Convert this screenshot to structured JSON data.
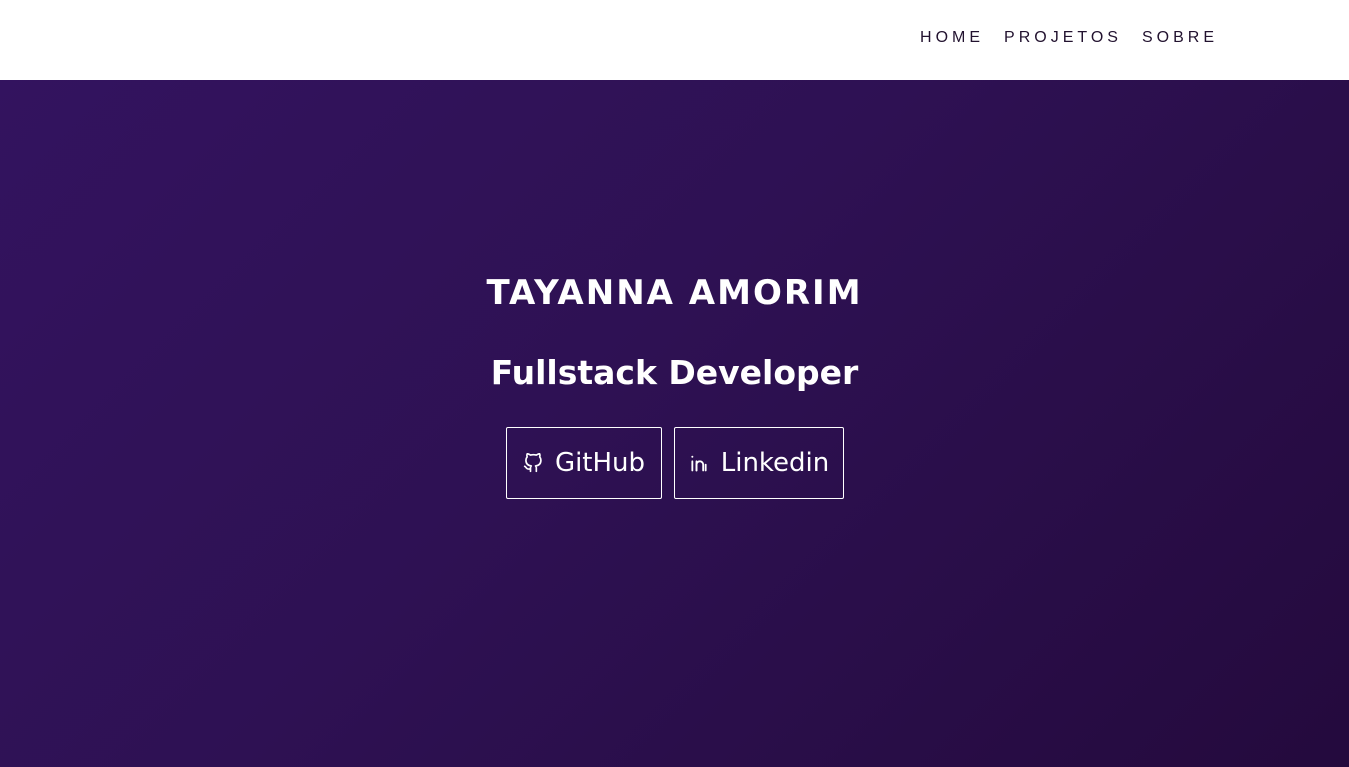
{
  "nav": {
    "items": [
      {
        "label": "HOME"
      },
      {
        "label": "PROJETOS"
      },
      {
        "label": "SOBRE"
      }
    ]
  },
  "hero": {
    "name": "TAYANNA AMORIM",
    "role": "Fullstack Developer",
    "buttons": [
      {
        "label": "GitHub",
        "icon": "github-icon"
      },
      {
        "label": "Linkedin",
        "icon": "linkedin-icon"
      }
    ]
  },
  "colors": {
    "background_top_left": "#33135f",
    "background_bottom_right": "#240a3d",
    "nav_text": "#22122f",
    "hero_text": "#ffffff"
  }
}
